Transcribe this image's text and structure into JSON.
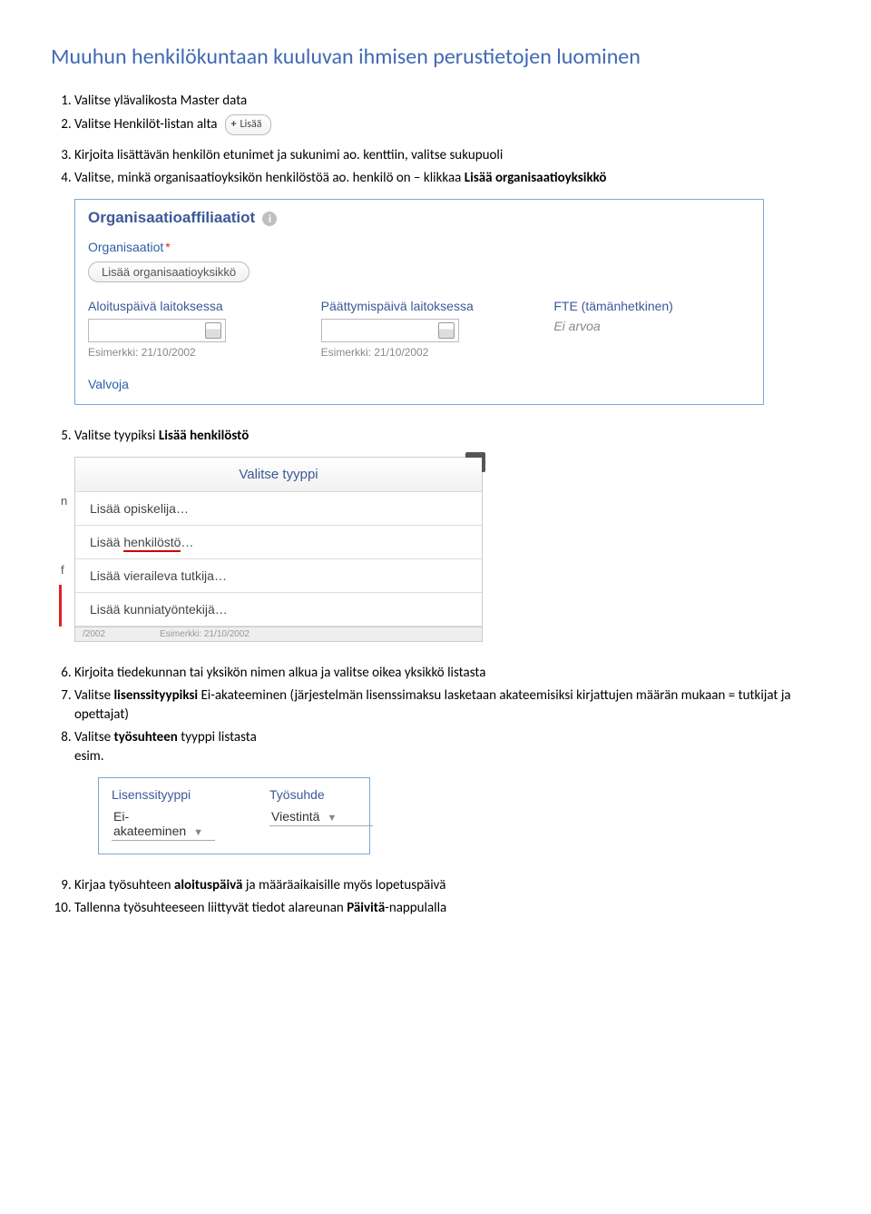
{
  "heading": "Muuhun henkilökuntaan kuuluvan ihmisen perustietojen luominen",
  "steps1": [
    {
      "num": "1.",
      "text": "Valitse ylävalikosta Master data"
    },
    {
      "num": "2.",
      "text": "Valitse Henkilöt-listan alta"
    }
  ],
  "add_button": {
    "plus": "+",
    "label": "Lisää"
  },
  "steps2": [
    {
      "num": "3.",
      "text": "Kirjoita lisättävän henkilön etunimet ja sukunimi ao. kenttiin, valitse sukupuoli"
    },
    {
      "num": "4.",
      "html": "Valitse, minkä organisaatioyksikön henkilöstöä ao. henkilö on – klikkaa <b>Lisää organisaatioyksikkö</b>"
    }
  ],
  "panel1": {
    "title": "Organisaatioaffiliaatiot",
    "info": "i",
    "org_label": "Organisaatiot",
    "add_org_btn": "Lisää organisaatioyksikkö",
    "start_label": "Aloituspäivä laitoksessa",
    "end_label": "Päättymispäivä laitoksessa",
    "fte_label": "FTE (tämänhetkinen)",
    "fte_value": "Ei arvoa",
    "example": "Esimerkki: 21/10/2002",
    "supervisor": "Valvoja"
  },
  "step5": {
    "num": "5.",
    "html": "Valitse tyypiksi <b>Lisää henkilöstö</b>"
  },
  "dialog": {
    "title": "Valitse tyyppi",
    "close": "×",
    "side_n": "n",
    "side_f": "f",
    "items": [
      "Lisää opiskelija…",
      "Lisää henkilöstö…",
      "Lisää vieraileva tutkija…",
      "Lisää kunniatyöntekijä…"
    ],
    "foot1": "/2002",
    "foot2": "Esimerkki: 21/10/2002"
  },
  "steps3": [
    {
      "num": "6.",
      "text": "Kirjoita tiedekunnan tai yksikön nimen alkua ja valitse oikea yksikkö listasta"
    },
    {
      "num": "7.",
      "html": "Valitse <b>lisenssityypiksi</b> Ei-akateeminen (järjestelmän lisenssimaksu lasketaan akateemisiksi kirjattujen määrän mukaan = tutkijat ja opettajat)"
    },
    {
      "num": "8.",
      "html": "Valitse <b>työsuhteen</b> tyyppi listasta<br>esim."
    }
  ],
  "panel3": {
    "lic_label": "Lisenssityyppi",
    "lic_value": "Ei-akateeminen",
    "emp_label": "Työsuhde",
    "emp_value": "Viestintä"
  },
  "steps4": [
    {
      "num": "9.",
      "html": "Kirjaa työsuhteen <b>aloituspäivä</b> ja määräaikaisille myös lopetuspäivä"
    },
    {
      "num": "10.",
      "html": "Tallenna työsuhteeseen liittyvät tiedot alareunan <b>Päivitä</b>-nappulalla"
    }
  ]
}
